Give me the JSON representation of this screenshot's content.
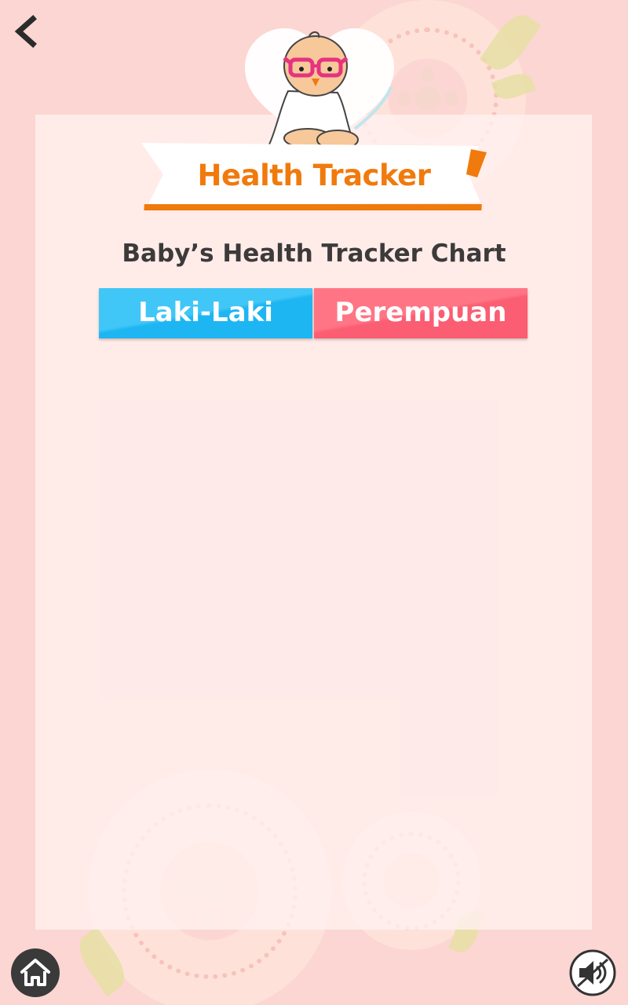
{
  "header": {
    "title": "Health Tracker",
    "subtitle": "Baby’s Health Tracker Chart"
  },
  "gender_options": {
    "boy_label": "Laki-Laki",
    "girl_label": "Perempuan"
  },
  "icons": {
    "back": "chevron-left-icon",
    "home": "home-icon",
    "sound": "sound-muted-icon",
    "mascot": "baby-doctor-mascot"
  },
  "colors": {
    "background": "#fcd6d2",
    "title_orange": "#f07a0c",
    "boy_blue": "#1db6f3",
    "girl_pink": "#fb5d72",
    "text_dark": "#3d3a3a"
  }
}
